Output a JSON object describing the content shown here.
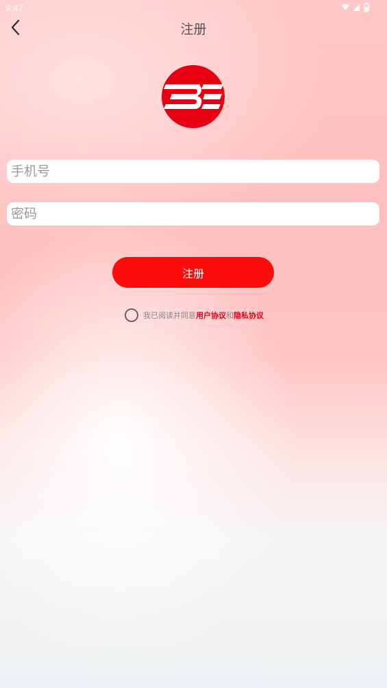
{
  "status_bar": {
    "time": "9:47",
    "icons": [
      "wifi-icon",
      "signal-icon",
      "battery-icon"
    ]
  },
  "header": {
    "title": "注册",
    "back_icon": "chevron-left-icon"
  },
  "logo": {
    "icon": "brand-logo-icon",
    "color": "#e60012"
  },
  "form": {
    "phone_placeholder": "手机号",
    "phone_value": "",
    "password_placeholder": "密码",
    "password_value": "",
    "submit_label": "注册"
  },
  "agreement": {
    "prefix": "我已阅读并同意",
    "user_agreement": "用户协议",
    "connector": "和",
    "privacy_agreement": "隐私协议",
    "checked": false
  },
  "colors": {
    "accent": "#fd0c0c",
    "link": "#e60012",
    "background_top": "#ffc4c4",
    "background_bottom": "#eef1f3"
  }
}
